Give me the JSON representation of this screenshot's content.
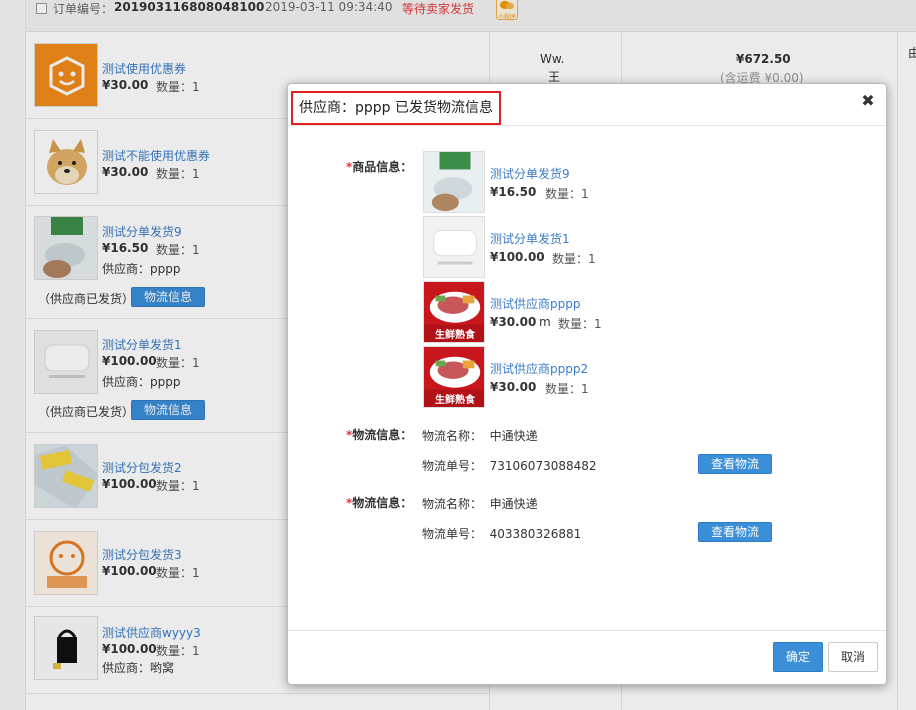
{
  "order": {
    "number_label": "订单编号：",
    "number": "201903116808048100",
    "time": "2019-03-11 09:34:40",
    "status": "等待卖家发货",
    "mini_program": "小程序",
    "buyer_line1": "Ww.",
    "buyer_line2": "王",
    "amount": "¥672.50",
    "freight_note": "(含运费 ¥0.00)",
    "edge_char": "由"
  },
  "list_items": [
    {
      "name": "测试使用优惠券",
      "price": "¥30.00",
      "qty": "数量：1"
    },
    {
      "name": "测试不能使用优惠券",
      "price": "¥30.00",
      "qty": "数量：1"
    },
    {
      "name": "测试分单发货9",
      "price": "¥16.50",
      "qty": "数量：1",
      "supplier": "供应商：pppp",
      "shipped": "（供应商已发货）",
      "logistics_btn": "物流信息"
    },
    {
      "name": "测试分单发货1",
      "price": "¥100.00",
      "qty": "数量：1",
      "supplier": "供应商：pppp",
      "shipped": "（供应商已发货）",
      "logistics_btn": "物流信息"
    },
    {
      "name": "测试分包发货2",
      "price": "¥100.00",
      "qty": "数量：1"
    },
    {
      "name": "测试分包发货3",
      "price": "¥100.00",
      "qty": "数量：1"
    },
    {
      "name": "测试供应商wyyy3",
      "price": "¥100.00",
      "qty": "数量：1",
      "supplier": "供应商：哟窝"
    }
  ],
  "modal": {
    "title": "供应商：pppp 已发货物流信息",
    "close_icon": "close-icon",
    "goods_label": "商品信息：",
    "goods": [
      {
        "name": "测试分单发货9",
        "price": "¥16.50",
        "unit": "",
        "qty": "数量：1"
      },
      {
        "name": "测试分单发货1",
        "price": "¥100.00",
        "unit": "",
        "qty": "数量：1"
      },
      {
        "name": "测试供应商pppp",
        "price": "¥30.00",
        "unit": "m",
        "qty": "数量：1",
        "badge": "生鲜熟食"
      },
      {
        "name": "测试供应商pppp2",
        "price": "¥30.00",
        "unit": "",
        "qty": "数量：1",
        "badge": "生鲜熟食"
      }
    ],
    "logistics": [
      {
        "label": "物流信息：",
        "name_line": "物流名称：  中通快递",
        "no_line": "物流单号：  73106073088482",
        "view_btn": "查看物流"
      },
      {
        "label": "物流信息：",
        "name_line": "物流名称：  申通快递",
        "no_line": "物流单号：  403380326881",
        "view_btn": "查看物流"
      }
    ],
    "ok_label": "确定",
    "cancel_label": "取消"
  }
}
